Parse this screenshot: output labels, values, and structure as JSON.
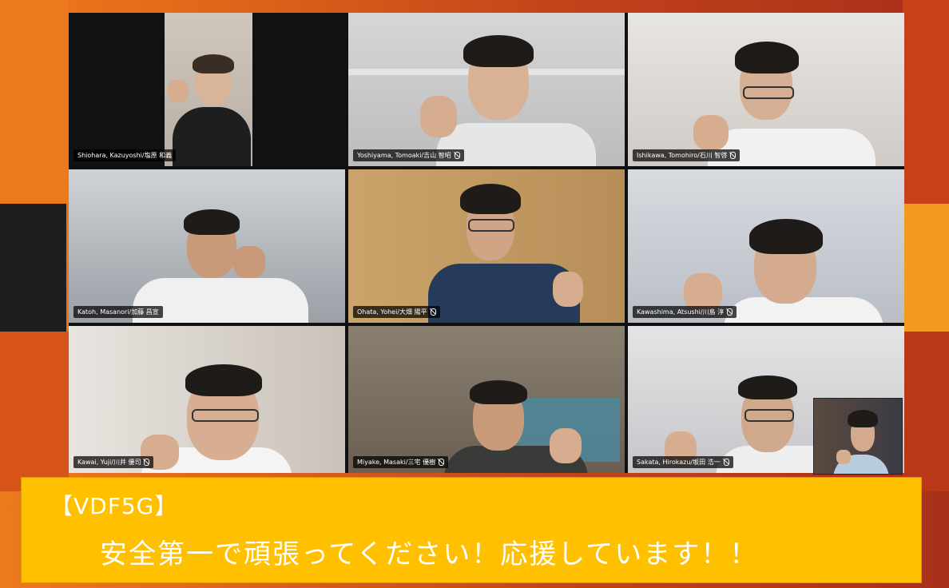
{
  "participants": [
    {
      "id": "p1",
      "name": "Shiohara, Kazuyoshi/塩原 和義"
    },
    {
      "id": "p2",
      "name": "Yoshiyama, Tomoaki/吉山 智昭"
    },
    {
      "id": "p3",
      "name": "Ishikawa, Tomohiro/石川 智啓"
    },
    {
      "id": "p4",
      "name": "Katoh, Masanori/加藤 昌宣"
    },
    {
      "id": "p5",
      "name": "Ohata, Yohei/大畑 陽平"
    },
    {
      "id": "p6",
      "name": "Kawashima, Atsushi/川島 淳"
    },
    {
      "id": "p7",
      "name": "Kawai, Yuji/川井 優司"
    },
    {
      "id": "p8",
      "name": "Miyake, Masaki/三宅 優樹"
    },
    {
      "id": "p9",
      "name": "Sakata, Hirokazu/坂田 浩一"
    }
  ],
  "banner": {
    "tag": "【VDF5G】",
    "message": "安全第一で頑張ってください！応援しています！！"
  },
  "colors": {
    "banner_bg": "#ffc000",
    "name_tag_bg": "#000000",
    "background_orange": "#e26a1a"
  },
  "icons": {
    "mic": "mic-muted-icon"
  }
}
